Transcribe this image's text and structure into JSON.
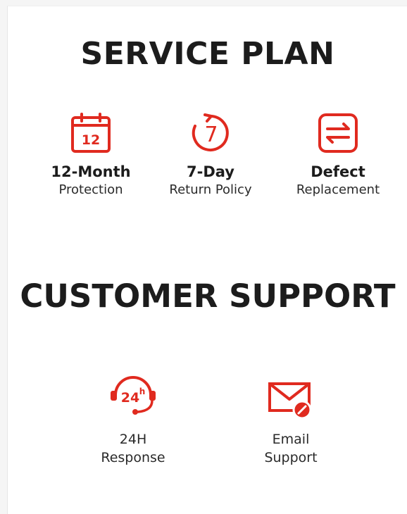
{
  "service_plan": {
    "title": "SERVICE PLAN",
    "items": [
      {
        "icon": "calendar-icon",
        "icon_text": "12",
        "bold": "12-Month",
        "sub": "Protection"
      },
      {
        "icon": "return-7-icon",
        "icon_text": "7",
        "bold": "7-Day",
        "sub": "Return Policy"
      },
      {
        "icon": "swap-arrows-icon",
        "bold": "Defect",
        "sub": "Replacement"
      }
    ]
  },
  "customer_support": {
    "title": "CUSTOMER SUPPORT",
    "items": [
      {
        "icon": "headset-24h-icon",
        "icon_text": "24",
        "icon_sup": "h",
        "line1": "24H",
        "line2": "Response"
      },
      {
        "icon": "email-icon",
        "line1": "Email",
        "line2": "Support"
      }
    ]
  },
  "colors": {
    "accent": "#e02a1f",
    "text_dark": "#1c1c1c",
    "text_body": "#2a2a2a",
    "background": "#ffffff"
  }
}
